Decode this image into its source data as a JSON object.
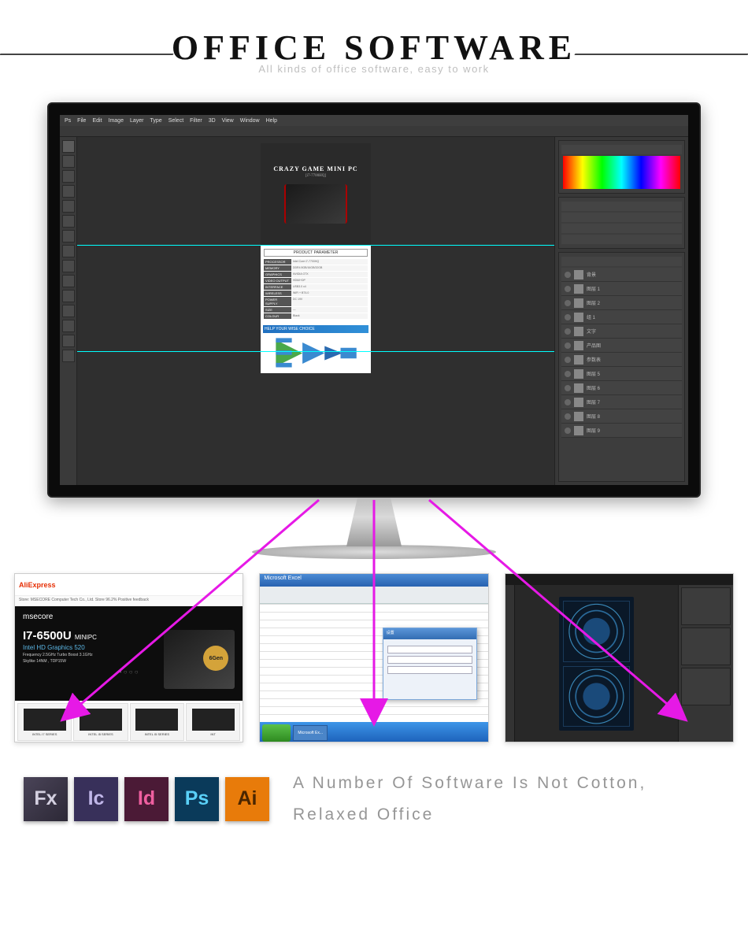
{
  "header": {
    "title": "OFFICE SOFTWARE",
    "subtitle": "All kinds of office software, easy to work"
  },
  "ps": {
    "menu": [
      "Ps",
      "File",
      "Edit",
      "Image",
      "Layer",
      "Type",
      "Select",
      "Filter",
      "3D",
      "View",
      "Window",
      "Help"
    ],
    "doc_title": "CRAZY GAME MINI PC",
    "doc_sub": "[i7-7700HQ]",
    "param_header": "PRODUCT PARAMETER",
    "params": [
      {
        "l": "PROCESSOR",
        "r": "Intel Core i7-7700HQ"
      },
      {
        "l": "MEMORY",
        "r": "DDR4 8GB/16GB/32GB"
      },
      {
        "l": "GRAPHICS",
        "r": "NVIDIA GTX"
      },
      {
        "l": "VIDEO OUTPUT",
        "r": "HDMI+DP"
      },
      {
        "l": "INTERFACE",
        "r": "USB3.0 x4"
      },
      {
        "l": "WIRELESS",
        "r": "WiFi + BT4.0"
      },
      {
        "l": "POWER SUPPLY",
        "r": "DC 19V"
      },
      {
        "l": "SIZE",
        "r": "—"
      },
      {
        "l": "COLOUR",
        "r": "Black"
      }
    ],
    "choice": "HELP YOUR WISE CHOICE",
    "layers": [
      "背景",
      "图层 1",
      "图层 2",
      "组 1",
      "文字",
      "产品图",
      "参数表",
      "图层 5",
      "图层 6",
      "图层 7",
      "图层 8",
      "图层 9"
    ]
  },
  "thumb1": {
    "logo": "AliExpress",
    "store": "Store: MSECORE Computer Tech Co., Ltd. Store   96.2% Positive feedback",
    "brand": "msecore",
    "prod": "I7-6500U",
    "prod_suffix": "MINIPC",
    "badge": "6Gen",
    "gpu": "Intel HD Graphics 520",
    "spec1": "Frequency 2.5GHz Turbo Boost 3.1GHz",
    "spec2": "Skylike 14NM , TDP15W",
    "cats": [
      "INTEL I7 SERIES",
      "INTEL I5 SERIES",
      "INTEL I5 SERIES",
      "INT"
    ]
  },
  "thumb2": {
    "title": "Microsoft Excel",
    "dlg_title": "设置",
    "tasks": [
      "开始",
      "Microsoft Ex..."
    ]
  },
  "adobe": [
    {
      "t": "Fx",
      "c": "fx"
    },
    {
      "t": "Ic",
      "c": "ic"
    },
    {
      "t": "Id",
      "c": "id"
    },
    {
      "t": "Ps",
      "c": "ps"
    },
    {
      "t": "Ai",
      "c": "ai"
    }
  ],
  "footer_text": "A Number Of Software Is Not Cotton, Relaxed Office"
}
